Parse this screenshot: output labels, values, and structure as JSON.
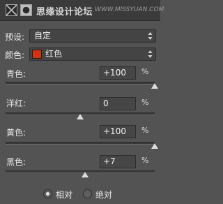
{
  "header": {
    "title": "思缘设计论坛",
    "watermark": "WWW.MISSYUAN.COM"
  },
  "preset": {
    "label": "预设:",
    "value": "自定"
  },
  "colors": {
    "label": "颜色:",
    "value": "红色",
    "swatch_color": "#d8300b"
  },
  "sliders": [
    {
      "label": "青色:",
      "value": "+100",
      "unit": "%",
      "level": 1.0
    },
    {
      "label": "洋红:",
      "value": "0",
      "unit": "%",
      "level": 0.5
    },
    {
      "label": "黄色:",
      "value": "+100",
      "unit": "%",
      "level": 1.0
    },
    {
      "label": "黑色:",
      "value": "+7",
      "unit": "%",
      "level": 0.535
    }
  ],
  "method": {
    "options": [
      "相对",
      "绝对"
    ],
    "selected": "相对"
  }
}
